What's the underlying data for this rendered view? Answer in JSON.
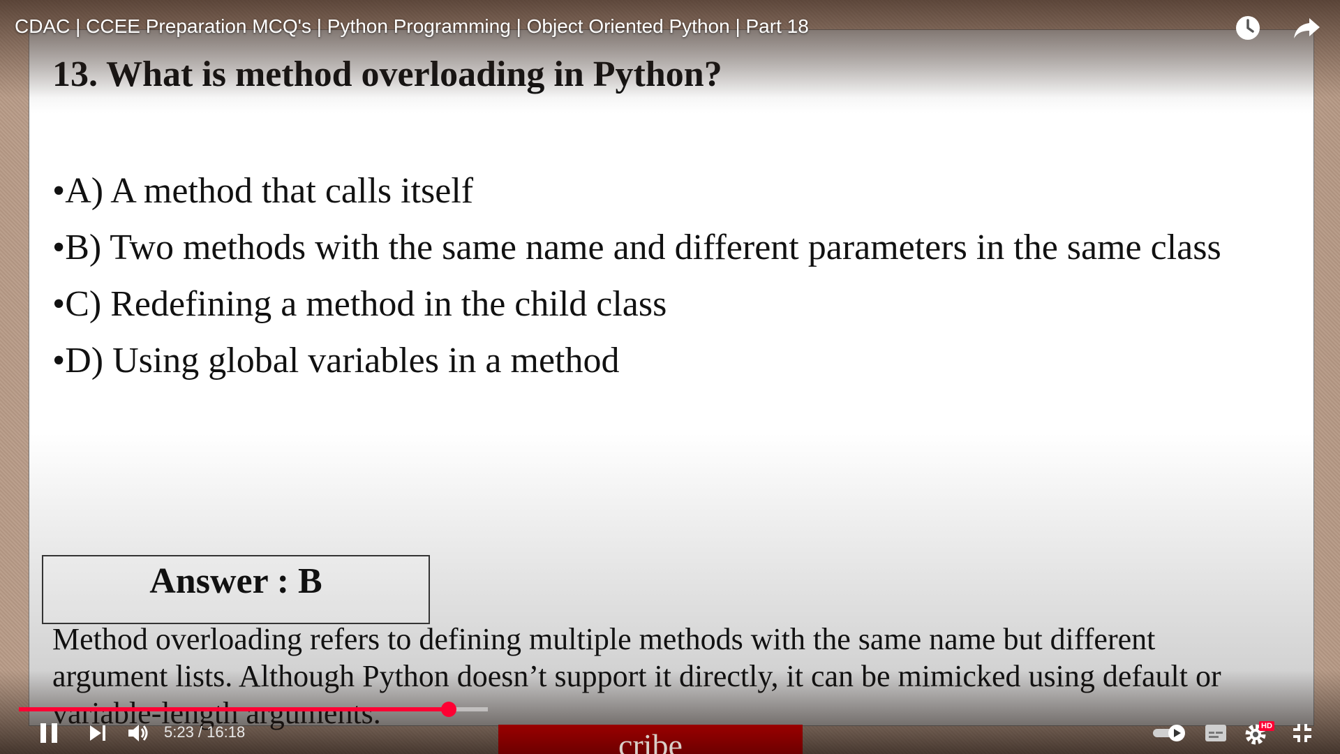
{
  "video": {
    "title": "CDAC | CCEE Preparation MCQ's | Python Programming | Object Oriented Python | Part 18",
    "current_time": "5:23",
    "duration": "16:18",
    "time_display": "5:23 / 16:18",
    "progress_fraction": 0.33,
    "buffered_fraction": 0.36,
    "accent_color": "#ff0033",
    "hd_badge": "HD"
  },
  "slide": {
    "question": "13. What is method overloading in Python?",
    "options": [
      "•A) A method that calls itself",
      "•B) Two methods with the same name and different parameters in the same class",
      "•C) Redefining a method in the child class",
      "•D) Using global variables in a method"
    ],
    "answer": "Answer : B",
    "explanation": "Method overloading refers to defining multiple methods with the same name but different\nargument lists. Although Python doesn’t support it directly, it can be mimicked using default or\nvariable-length arguments."
  },
  "banner": {
    "text": "cribe",
    "color": "#9a0000"
  },
  "icons": {
    "top": [
      "clock-icon",
      "share-icon"
    ],
    "left_controls": [
      "pause-icon",
      "next-icon",
      "volume-icon"
    ],
    "right_controls": [
      "autoplay-toggle-icon",
      "subtitles-icon",
      "settings-icon",
      "exit-fullscreen-icon"
    ]
  }
}
